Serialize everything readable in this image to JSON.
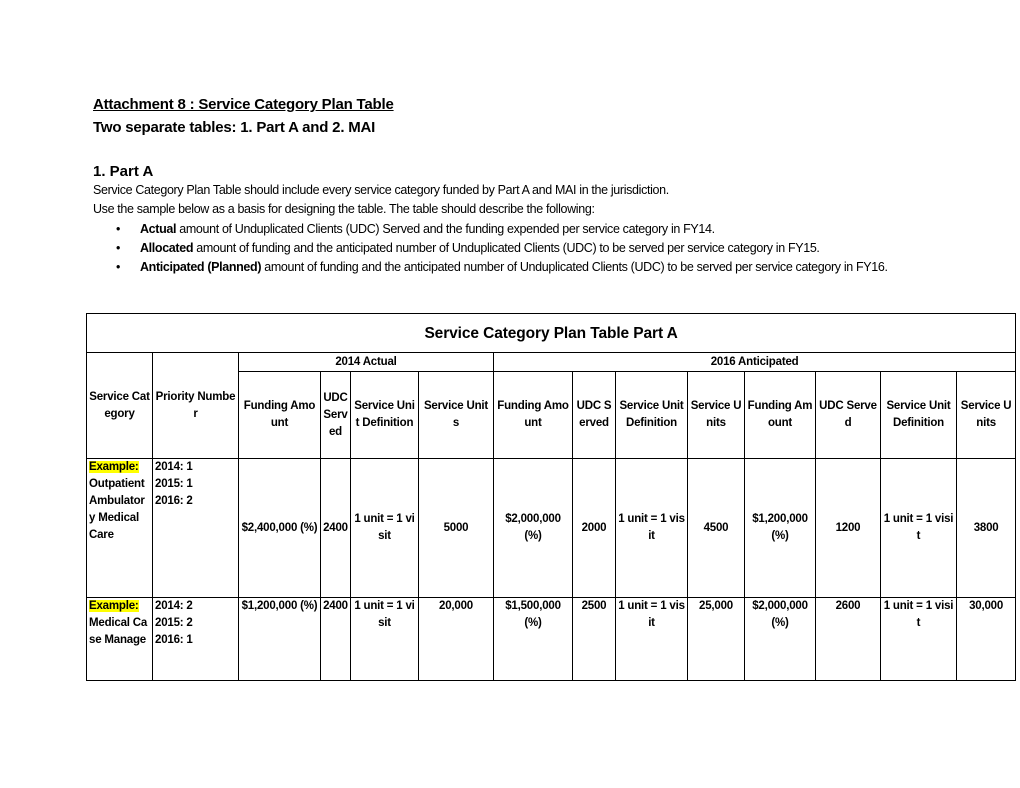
{
  "document": {
    "title": "Attachment 8 : Service Category Plan Table ",
    "subtitle": "Two separate tables:  1. Part A and 2. MAI",
    "section_heading": "1. Part A",
    "paragraphs": [
      "Service Category Plan Table should include every service category funded by Part A and MAI in the jurisdiction.",
      "Use the sample below as a basis for designing the table. The table should describe the following:"
    ],
    "bullets": [
      {
        "bold": "Actual",
        "text": " amount of Unduplicated Clients (UDC) Served and the funding expended per service category in FY14."
      },
      {
        "bold": "Allocated",
        "text": " amount of funding and the anticipated number of Unduplicated Clients (UDC) to be served per service category in FY15."
      },
      {
        "bold": "Anticipated (Planned)",
        "text": " amount of funding and the anticipated number of Unduplicated Clients (UDC) to be served per service category in FY16."
      }
    ],
    "bullet_icon": "bullet-dot-icon",
    "bullet_glyph": "•"
  },
  "table": {
    "caption": "Service Category Plan Table Part A",
    "group_headers": [
      "2014 Actual",
      "2016 Anticipated"
    ],
    "row_headers": [
      "Service Category",
      "Priority Number"
    ],
    "column_headers": [
      "Funding Amount",
      "UDC Served",
      "Service Unit Definition",
      "Service Units",
      "Funding Amount",
      "UDC Served",
      "Service Unit Definition",
      "Service Units",
      "Funding Amount",
      "UDC Served",
      "Service Unit Definition",
      "Service Units"
    ],
    "highlight_color": "#ffff00",
    "rows": [
      {
        "example_label": "Example:",
        "category": "Outpatient Ambulatory Medical Care",
        "priority": "2014: 1\n2015: 1\n2016: 2",
        "cells": [
          "$2,400,000 (%)",
          "2400",
          "1 unit = 1 visit",
          "5000",
          "$2,000,000 (%)",
          "2000",
          "1 unit = 1 visit",
          "4500",
          "$1,200,000 (%)",
          "1200",
          "1 unit = 1 visit",
          "3800"
        ]
      },
      {
        "example_label": "Example:",
        "category": "Medical Case Manage",
        "priority": "2014: 2\n2015: 2\n2016: 1",
        "cells": [
          "$1,200,000 (%)",
          "2400",
          "1 unit = 1 visit",
          "20,000",
          "$1,500,000 (%)",
          "2500",
          "1 unit = 1 visit",
          "25,000",
          "$2,000,000 (%)",
          "2600",
          "1 unit = 1 visit",
          "30,000"
        ]
      }
    ]
  }
}
